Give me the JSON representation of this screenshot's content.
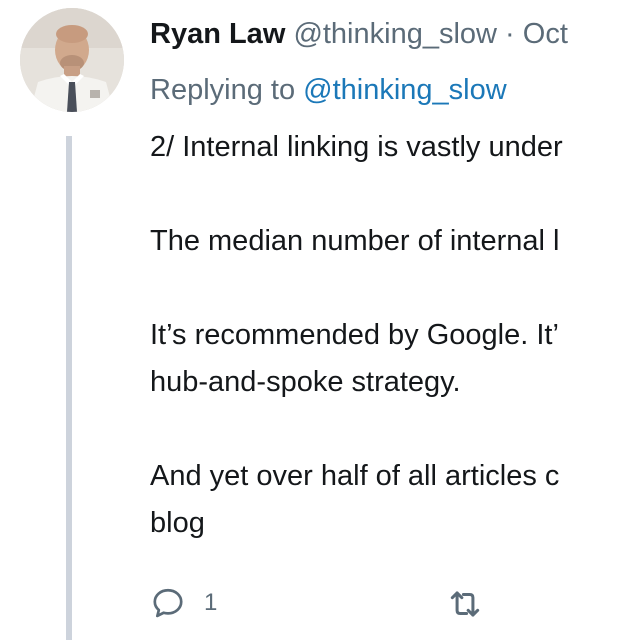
{
  "tweet": {
    "display_name": "Ryan Law",
    "handle": "@thinking_slow",
    "separator": " · ",
    "date": "Oct",
    "replying_prefix": "Replying to ",
    "replying_handle": "@thinking_slow",
    "paragraphs": [
      [
        "2/ Internal linking is vastly under"
      ],
      [
        "The median number of internal l"
      ],
      [
        "It’s recommended by Google. It’",
        "hub-and-spoke strategy."
      ],
      [
        "And yet over half of all articles c",
        "blog"
      ]
    ]
  },
  "actions": {
    "reply_icon": "reply-bubble-icon",
    "reply_count": "1",
    "retweet_icon": "retweet-icon"
  },
  "colors": {
    "name": "#14171a",
    "muted": "#5b6b78",
    "link": "#1b78b8",
    "thread_line": "#cdd3dc"
  }
}
